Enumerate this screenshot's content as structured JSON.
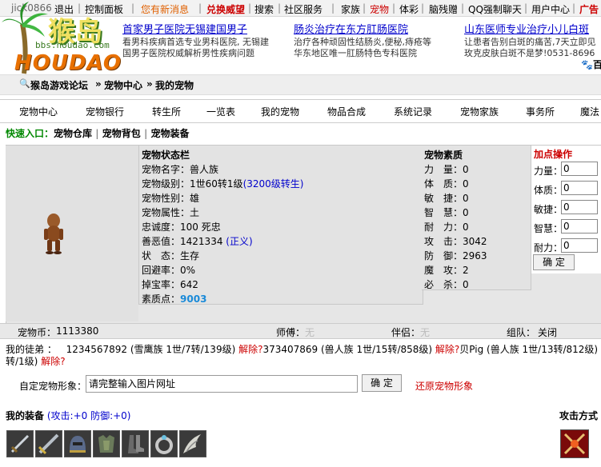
{
  "topbar": {
    "user": "jick0866",
    "logout": "退出",
    "control_panel": "控制面板",
    "new_message": "您有新消息",
    "exchange": "兑换威望",
    "search": "搜索",
    "community": "社区服务",
    "family": "家族",
    "pet": "宠物",
    "lottery": "体彩",
    "gift": "脑残赠",
    "qq": "QQ强制聊天",
    "user_center": "用户中心",
    "ads": "广告"
  },
  "logo": {
    "cn": "猴岛",
    "url_text": "bbs.houdao.com",
    "en": "HOUDAO"
  },
  "ads": [
    {
      "title": "首家男子医院无锡建国男子",
      "line1": "看男科疾病首选专业男科医院, 无锡建",
      "line2": "国男子医院权威解析男性疾病问题"
    },
    {
      "title": "肠炎治疗在东方肛肠医院",
      "line1": "治疗各种顽固性结肠炎,便秘,痔疮等",
      "line2": "华东地区唯一肛肠特色专科医院"
    },
    {
      "title": "山东医师专业治疗小儿白斑",
      "line1": "让患者告别白斑的痛苦,7天立即见",
      "line2": "玫克皮肤白斑不是梦!0531-8696"
    }
  ],
  "ad_suffix": "百",
  "breadcrumb": {
    "forum": "猴岛游戏论坛",
    "sep1": "»",
    "center": "宠物中心",
    "sep2": "»",
    "current": "我的宠物"
  },
  "nav": [
    "宠物中心",
    "宠物银行",
    "转生所",
    "一览表",
    "我的宠物",
    "物品合成",
    "系统记录",
    "宠物家族",
    "事务所",
    "魔法"
  ],
  "quick": {
    "label": "快速入口：",
    "items": [
      "宠物仓库",
      "宠物背包",
      "宠物装备"
    ]
  },
  "status": {
    "title": "宠物状态栏",
    "rows": [
      {
        "label": "宠物名字：",
        "value": "兽人族"
      },
      {
        "label": "宠物级别：",
        "value": "1世60转1级",
        "extra": "(3200级转生)"
      },
      {
        "label": "宠物性别：",
        "value": "雄"
      },
      {
        "label": "宠物属性：",
        "value": "土"
      },
      {
        "label": "忠诚度：",
        "value": "100 死忠"
      },
      {
        "label": "善恶值：",
        "value": "1421334",
        "extra": "(正义)"
      },
      {
        "label": "状　态：",
        "value": "生存"
      },
      {
        "label": "回避率：",
        "value": "0%"
      },
      {
        "label": "掉宝率：",
        "value": "642"
      },
      {
        "label": "素质点：",
        "value": "9003"
      }
    ]
  },
  "quality": {
    "title": "宠物素质",
    "rows": [
      {
        "label": "力　量：",
        "value": "0"
      },
      {
        "label": "体　质：",
        "value": "0"
      },
      {
        "label": "敏　捷：",
        "value": "0"
      },
      {
        "label": "智　慧：",
        "value": "0"
      },
      {
        "label": "耐　力：",
        "value": "0"
      },
      {
        "label": "攻　击：",
        "value": "3042"
      },
      {
        "label": "防　御：",
        "value": "2963"
      },
      {
        "label": "魔　攻：",
        "value": "2"
      },
      {
        "label": "必　杀：",
        "value": "0"
      }
    ]
  },
  "points": {
    "title": "加点操作",
    "rows": [
      {
        "label": "力量：",
        "value": "0"
      },
      {
        "label": "体质：",
        "value": "0"
      },
      {
        "label": "敏捷：",
        "value": "0"
      },
      {
        "label": "智慧：",
        "value": "0"
      },
      {
        "label": "耐力：",
        "value": "0"
      }
    ],
    "ok": "确 定"
  },
  "coinbar": {
    "coin_label": "宠物币：",
    "coin": "1113380",
    "master_label": "师傅：",
    "master": "无",
    "partner_label": "伴侣：",
    "partner": "无",
    "team_label": "组队：",
    "team": "关闭"
  },
  "disciples": {
    "label": "我的徒弟 ：",
    "list": [
      {
        "text": "1234567892 (雪鹰族 1世/7转/139级)",
        "action": "解除?"
      },
      {
        "text": "373407869 (兽人族 1世/15转/858级)",
        "action": "解除?"
      },
      {
        "text": "贝Pig (兽人族 1世/13转/812级)",
        "action": "解除"
      }
    ],
    "cont_text": "转/1级)",
    "cont_action": "解除?"
  },
  "custom": {
    "label": "自定宠物形象：",
    "placeholder": "请完整输入图片网址",
    "ok": "确 定",
    "restore": "还原宠物形象"
  },
  "equipment": {
    "label": "我的装备",
    "stats": "(攻击:+0 防御:+0)",
    "attack_mode": "攻击方式"
  },
  "equip_items": [
    "dagger-icon",
    "sword-icon",
    "helmet-icon",
    "armor-icon",
    "boots-icon",
    "ring-icon",
    "claw-icon"
  ]
}
